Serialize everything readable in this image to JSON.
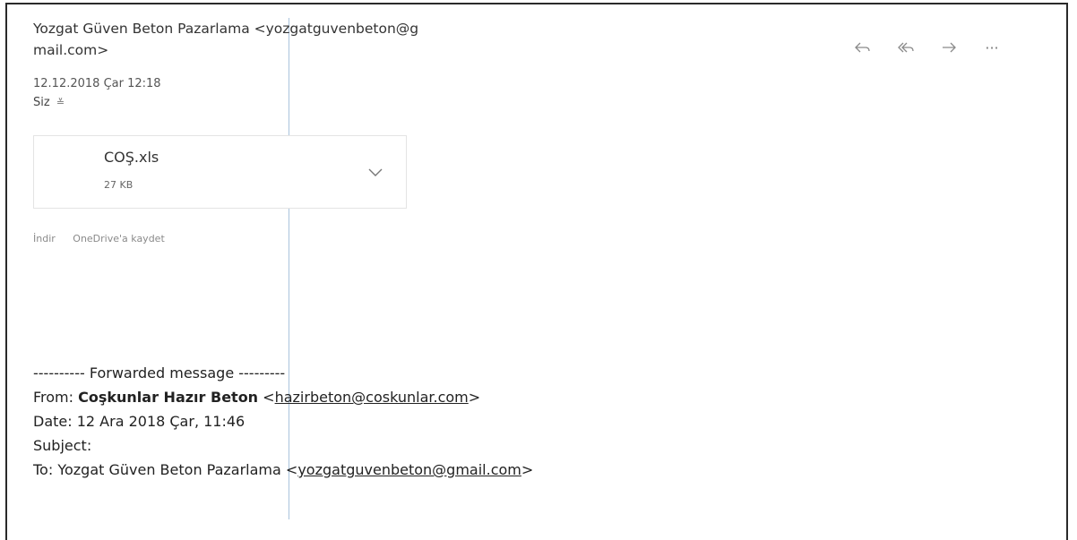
{
  "message": {
    "sender_line1": "Yozgat Güven Beton Pazarlama <yozgatguvenbeton@g",
    "sender_line2": "mail.com>",
    "date": "12.12.2018 Çar 12:18",
    "to_label": "Siz",
    "to_chevron": "≚"
  },
  "actions": [
    {
      "name": "reply-icon"
    },
    {
      "name": "reply-all-icon"
    },
    {
      "name": "forward-icon"
    },
    {
      "name": "more-icon",
      "label": "···"
    }
  ],
  "attachment": {
    "file_name": "COŞ.xls",
    "file_size": "27 KB",
    "icon": "chevron-down-icon"
  },
  "attachment_links": {
    "download": "İndir",
    "save_onedrive": "OneDrive'a kaydet"
  },
  "forwarded": {
    "header": "---------- Forwarded message ---------",
    "from_label": "From:",
    "from_name": "Coşkunlar Hazır Beton",
    "from_email": "hazirbeton@coskunlar.com",
    "date_line": "Date: 12 Ara 2018 Çar, 11:46",
    "subject_line": "Subject:",
    "to_label": "To: Yozgat Güven Beton Pazarlama",
    "to_email": "yozgatguvenbeton@gmail.com"
  }
}
